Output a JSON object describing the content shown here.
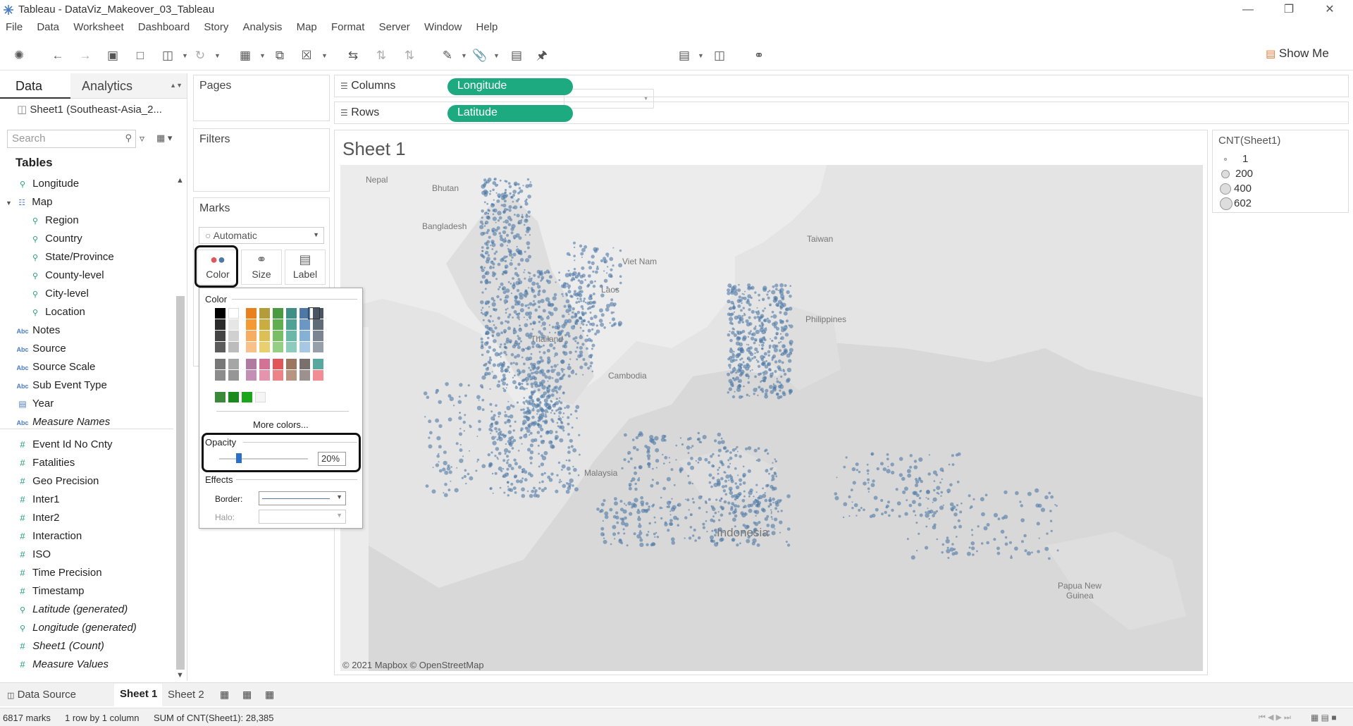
{
  "window": {
    "title": "Tableau - DataViz_Makeover_03_Tableau"
  },
  "menu": [
    "File",
    "Data",
    "Worksheet",
    "Dashboard",
    "Story",
    "Analysis",
    "Map",
    "Format",
    "Server",
    "Window",
    "Help"
  ],
  "toolbar": {
    "show_me": "Show Me"
  },
  "data_pane": {
    "tab_data": "Data",
    "tab_analytics": "Analytics",
    "datasource": "Sheet1 (Southeast-Asia_2...",
    "search_placeholder": "Search",
    "tables_heading": "Tables",
    "fields": [
      {
        "label": "Longitude",
        "icon": "globe"
      },
      {
        "label": "Map",
        "icon": "hierarchy"
      },
      {
        "label": "Region",
        "icon": "globe"
      },
      {
        "label": "Country",
        "icon": "globe"
      },
      {
        "label": "State/Province",
        "icon": "globe"
      },
      {
        "label": "County-level",
        "icon": "globe"
      },
      {
        "label": "City-level",
        "icon": "globe"
      },
      {
        "label": "Location",
        "icon": "globe"
      },
      {
        "label": "Notes",
        "icon": "abc"
      },
      {
        "label": "Source",
        "icon": "abc"
      },
      {
        "label": "Source Scale",
        "icon": "abc"
      },
      {
        "label": "Sub Event Type",
        "icon": "abc"
      },
      {
        "label": "Year",
        "icon": "calendar"
      },
      {
        "label": "Measure Names",
        "icon": "abc"
      },
      {
        "label": "Event Id No Cnty",
        "icon": "number"
      },
      {
        "label": "Fatalities",
        "icon": "number"
      },
      {
        "label": "Geo Precision",
        "icon": "number"
      },
      {
        "label": "Inter1",
        "icon": "number"
      },
      {
        "label": "Inter2",
        "icon": "number"
      },
      {
        "label": "Interaction",
        "icon": "number"
      },
      {
        "label": "ISO",
        "icon": "number"
      },
      {
        "label": "Time Precision",
        "icon": "number"
      },
      {
        "label": "Timestamp",
        "icon": "number"
      },
      {
        "label": "Latitude (generated)",
        "icon": "globe"
      },
      {
        "label": "Longitude (generated)",
        "icon": "globe"
      },
      {
        "label": "Sheet1 (Count)",
        "icon": "number"
      },
      {
        "label": "Measure Values",
        "icon": "number"
      }
    ]
  },
  "cards": {
    "pages": "Pages",
    "filters": "Filters",
    "marks": "Marks",
    "mark_type": "Automatic",
    "color": "Color",
    "size": "Size",
    "label": "Label"
  },
  "shelves": {
    "columns_label": "Columns",
    "columns_pill": "Longitude",
    "rows_label": "Rows",
    "rows_pill": "Latitude"
  },
  "sheet": {
    "title": "Sheet 1",
    "attribution": "© 2021 Mapbox © OpenStreetMap"
  },
  "map_labels": {
    "nepal": "Nepal",
    "bhutan": "Bhutan",
    "bangladesh": "Bangladesh",
    "taiwan": "Taiwan",
    "vietnam": "Viet Nam",
    "laos": "Laos",
    "thailand": "Thailand",
    "cambodia": "Cambodia",
    "philippines": "Philippines",
    "malaysia": "Malaysia",
    "indonesia": "Indonesia",
    "png1": "Papua New",
    "png2": "Guinea"
  },
  "legend": {
    "title": "CNT(Sheet1)",
    "items": [
      "1",
      "200",
      "400",
      "602"
    ]
  },
  "color_popup": {
    "color_heading": "Color",
    "more_colors": "More colors...",
    "opacity_heading": "Opacity",
    "opacity_value": "20%",
    "effects_heading": "Effects",
    "border_label": "Border:",
    "halo_label": "Halo:"
  },
  "mark_color": "#4e79a7",
  "bottom_tabs": {
    "data_source": "Data Source",
    "sheet1": "Sheet 1",
    "sheet2": "Sheet 2"
  },
  "status": {
    "marks": "6817 marks",
    "rows_cols": "1 row by 1 column",
    "sum": "SUM of CNT(Sheet1): 28,385"
  }
}
